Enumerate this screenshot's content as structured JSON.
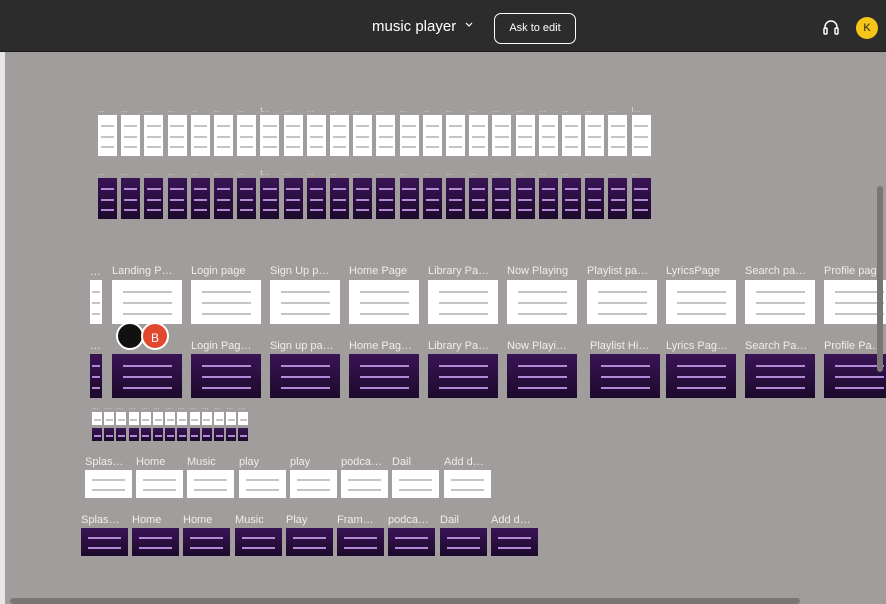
{
  "header": {
    "file_name": "music player",
    "ask_to_edit": "Ask to edit",
    "user_initial": "K"
  },
  "cursors": {
    "user_b": "B"
  },
  "frame_rows": {
    "row_a_labels": [
      "…",
      "…",
      "…",
      "…",
      "…",
      "…",
      "…",
      "t…",
      "…",
      "…",
      "…",
      "…",
      "…",
      "…",
      "…",
      "…",
      "…",
      "…",
      "…",
      "…",
      "…",
      "…",
      "…",
      "I…"
    ],
    "row_b_labels": [
      "…",
      "…",
      "…",
      "…",
      "…",
      "…",
      "…",
      "t…",
      "…",
      "…",
      "…",
      "…",
      "…",
      "…",
      "…",
      "…",
      "…",
      "…",
      "…",
      "…",
      "…",
      "…",
      "…",
      "…"
    ],
    "desktop_wire": [
      "…",
      "Landing P…",
      "Login page",
      "Sign Up p…",
      "Home Page",
      "Library Pa…",
      "Now Playing",
      "Playlist pa…",
      "LyricsPage",
      "Search pa…",
      "Profile page"
    ],
    "desktop_dark": [
      "…",
      "Login Pag…",
      "Sign up pa…",
      "Home Pag…",
      "Library Pa…",
      "Now Playi…",
      "Playlist Hi…",
      "Lyrics Pag…",
      "Search Pa…",
      "Profile Pa…"
    ],
    "small_grid_labels": [
      "…",
      "…",
      "…",
      "…",
      "…",
      "…",
      "…",
      "…",
      "…",
      "…",
      "…",
      "…",
      "…"
    ],
    "car_wire": [
      "Splas…",
      "Home",
      "Music",
      "play",
      "play",
      "podca…",
      "Dail",
      "Add d…"
    ],
    "car_dark": [
      "Splas…",
      "Home",
      "Home",
      "Music",
      "Play",
      "Fram…",
      "podca…",
      "Dail",
      "Add d…"
    ]
  },
  "colors": {
    "canvas": "#a19d9d",
    "topbar": "#2c2c2c",
    "avatar": "#f5c518",
    "cursor_b": "#e2482d",
    "dark_frame": "#2a0f3d",
    "accent_purple": "#7b2cbf"
  }
}
